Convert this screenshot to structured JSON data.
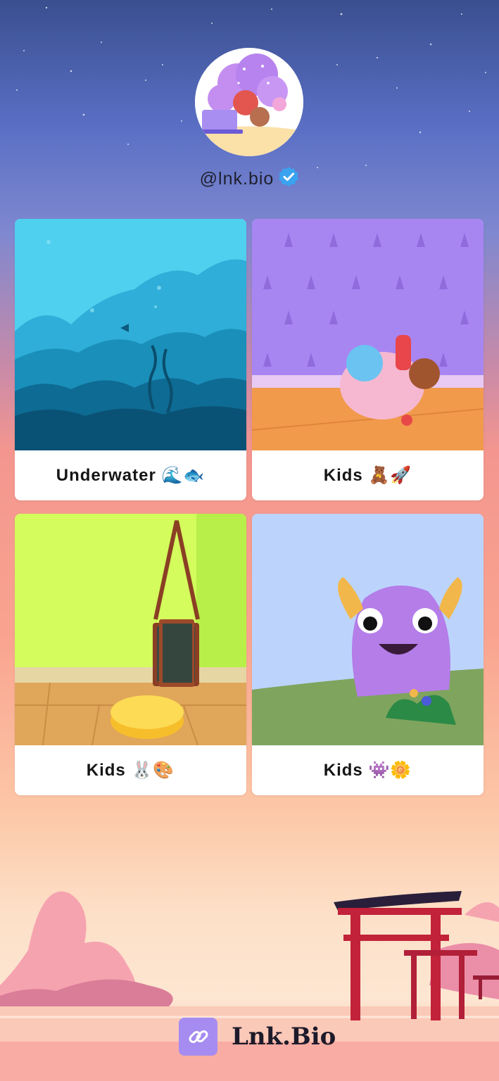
{
  "profile": {
    "handle": "@lnk.bio",
    "verified_icon": "verified-badge-icon",
    "verified_color": "#3aa3f0"
  },
  "cards": [
    {
      "label": "Underwater 🌊🐟",
      "image": "underwater-scene"
    },
    {
      "label": "Kids 🧸🚀",
      "image": "toy-basket-scene"
    },
    {
      "label": "Kids 🐰🎨",
      "image": "chalkboard-room-scene"
    },
    {
      "label": "Kids 👾🌼",
      "image": "purple-monster-scene"
    }
  ],
  "footer": {
    "brand": "Lnk.Bio",
    "logo_icon": "link-icon",
    "logo_color": "#a68cf0"
  }
}
